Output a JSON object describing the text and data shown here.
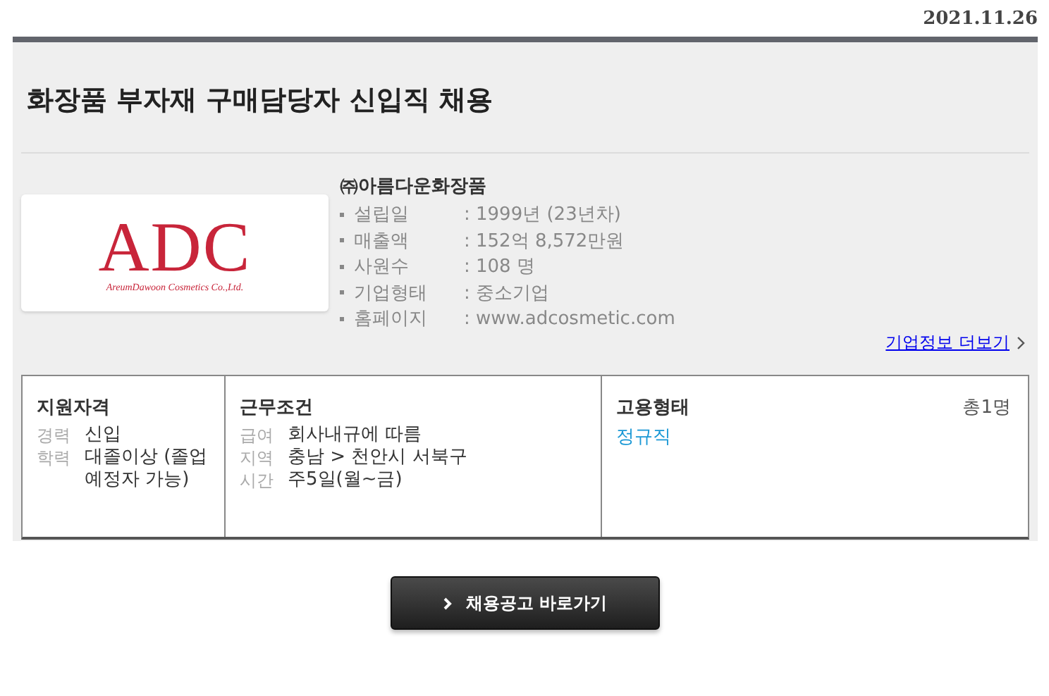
{
  "date": "2021.11.26",
  "title": "화장품 부자재 구매담당자 신입직 채용",
  "company": {
    "logo": {
      "mark": "ADC",
      "subtitle": "AreumDawoon Cosmetics Co.,Ltd."
    },
    "name": "㈜아름다운화장품",
    "facts": [
      {
        "label": "설립일",
        "value": ": 1999년 (23년차)"
      },
      {
        "label": "매출액",
        "value": ": 152억 8,572만원"
      },
      {
        "label": "사원수",
        "value": ": 108 명"
      },
      {
        "label": "기업형태",
        "value": ": 중소기업"
      },
      {
        "label": "홈페이지",
        "value": ": www.adcosmetic.com"
      }
    ],
    "more_link": "기업정보 더보기"
  },
  "conditions": [
    {
      "heading": "지원자격",
      "items": [
        {
          "label": "경력",
          "value": "신입"
        },
        {
          "label": "학력",
          "value": "대졸이상 (졸업예정자 가능)"
        }
      ]
    },
    {
      "heading": "근무조건",
      "items": [
        {
          "label": "급여",
          "value": "회사내규에 따름"
        },
        {
          "label": "지역",
          "value": "충남 > 천안시 서북구"
        },
        {
          "label": "시간",
          "value": "주5일(월~금)"
        }
      ]
    },
    {
      "heading": "고용형태",
      "count": "총1명",
      "types": [
        "정규직"
      ]
    }
  ],
  "apply_button": "채용공고 바로가기"
}
